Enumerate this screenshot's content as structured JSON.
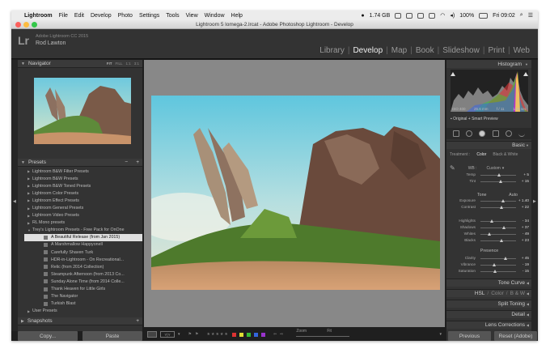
{
  "menubar": {
    "items": [
      "Lightroom",
      "File",
      "Edit",
      "Develop",
      "Photo",
      "Settings",
      "Tools",
      "View",
      "Window",
      "Help"
    ],
    "memory": "1.74 GB",
    "battery": "100%",
    "clock": "Fri 09:02"
  },
  "window": {
    "title": "Lightroom 5 lomega-2.lrcat - Adobe Photoshop Lightroom - Develop"
  },
  "identity": {
    "logo": "Lr",
    "product": "Adobe Lightroom CC 2015",
    "user": "Rod Lawton"
  },
  "modules": [
    "Library",
    "Develop",
    "Map",
    "Book",
    "Slideshow",
    "Print",
    "Web"
  ],
  "active_module": "Develop",
  "navigator": {
    "label": "Navigator",
    "zooms": [
      "FIT",
      "FILL",
      "1:1",
      "3:1"
    ]
  },
  "presets": {
    "label": "Presets",
    "items": [
      {
        "label": "Lightroom B&W Filter Presets"
      },
      {
        "label": "Lightroom B&W Presets"
      },
      {
        "label": "Lightroom B&W Toned Presets"
      },
      {
        "label": "Lightroom Color Presets"
      },
      {
        "label": "Lightroom Effect Presets"
      },
      {
        "label": "Lightroom General Presets"
      },
      {
        "label": "Lightroom Video Presets"
      },
      {
        "label": "RL Mono presets"
      },
      {
        "label": "Trey's Lightroom Presets - Free Pack for OnOne"
      },
      {
        "label": "A Beautiful Release (from Jan 2015)"
      },
      {
        "label": "A Marshmallow Happyonell"
      },
      {
        "label": "Carefully Shaven Turk"
      },
      {
        "label": "HDR-in-Lightroom - On Recreational..."
      },
      {
        "label": "Relic (from 2014 Collection)"
      },
      {
        "label": "Steampunk Afternoon (from 2013 Co..."
      },
      {
        "label": "Sunday Alone Time (from 2014 Colle..."
      },
      {
        "label": "Thank Heaven for Little Girls"
      },
      {
        "label": "The Navigator"
      },
      {
        "label": "Turkish Blast"
      },
      {
        "label": "User Presets"
      }
    ]
  },
  "snapshots": {
    "label": "Snapshots"
  },
  "left_buttons": {
    "copy": "Copy...",
    "paste": "Paste"
  },
  "toolbar": {
    "yy": "Y|Y",
    "zoom_label": "Zoom",
    "zoom_value": "Fit"
  },
  "histogram": {
    "label": "Histogram",
    "iso": "ISO 400",
    "focal": "25.6 mm",
    "aperture": "f / 11",
    "shutter": "1/25 sec",
    "preview": "Original + Smart Preview"
  },
  "basic": {
    "label": "Basic",
    "treatment_label": "Treatment :",
    "color": "Color",
    "bw": "Black & White",
    "wb_label": "WB :",
    "wb_value": "Custom",
    "tone_label": "Tone",
    "auto": "Auto",
    "presence_label": "Presence",
    "sliders": [
      {
        "label": "Temp",
        "value": "+ 5",
        "pos": 0.53
      },
      {
        "label": "Tint",
        "value": "+ 15",
        "pos": 0.58
      },
      {
        "label": "Exposure",
        "value": "+ 1.40",
        "pos": 0.64
      },
      {
        "label": "Contrast",
        "value": "+ 22",
        "pos": 0.61
      },
      {
        "label": "Highlights",
        "value": "- 34",
        "pos": 0.33
      },
      {
        "label": "Shadows",
        "value": "+ 37",
        "pos": 0.68
      },
      {
        "label": "Whites",
        "value": "- 49",
        "pos": 0.26
      },
      {
        "label": "Blacks",
        "value": "+ 23",
        "pos": 0.61
      },
      {
        "label": "Clarity",
        "value": "+ 45",
        "pos": 0.72
      },
      {
        "label": "Vibrance",
        "value": "- 19",
        "pos": 0.4
      },
      {
        "label": "Saturation",
        "value": "- 15",
        "pos": 0.42
      }
    ]
  },
  "sections": {
    "tone_curve": "Tone Curve",
    "hsl": "HSL",
    "color": "Color",
    "bw": "B & W",
    "split": "Split Toning",
    "detail": "Detail",
    "lens": "Lens Corrections"
  },
  "right_buttons": {
    "previous": "Previous",
    "reset": "Reset (Adobe)"
  },
  "colors": {
    "panel": "#333333",
    "bg": "#1f1f1f",
    "center": "#888888"
  }
}
